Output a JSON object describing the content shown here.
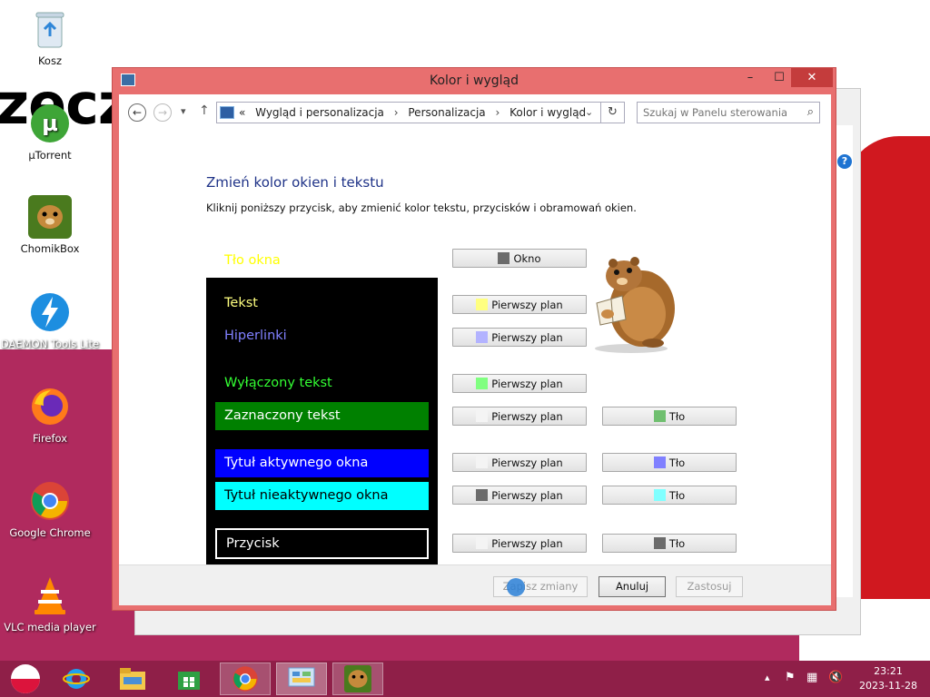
{
  "desktop": {
    "wallpaper_text": "zecz",
    "icons": [
      {
        "label": "Kosz",
        "icon": "recycle-bin-icon"
      },
      {
        "label": "µTorrent",
        "icon": "utorrent-icon"
      },
      {
        "label": "ChomikBox",
        "icon": "chomikbox-icon"
      },
      {
        "label": "DAEMON Tools Lite",
        "icon": "daemon-tools-icon"
      },
      {
        "label": "Firefox",
        "icon": "firefox-icon"
      },
      {
        "label": "Google Chrome",
        "icon": "chrome-icon"
      },
      {
        "label": "VLC media player",
        "icon": "vlc-icon"
      }
    ]
  },
  "dialog": {
    "title": "Kolor i wygląd",
    "controls": {
      "minimize": "–",
      "maximize": "☐",
      "close": "✕"
    },
    "nav": {
      "back": "←",
      "forward": "→",
      "recent": "▾",
      "up": "↑",
      "crumb_prefix": "«",
      "breadcrumb": [
        "Wygląd i personalizacja",
        "Personalizacja",
        "Kolor i wygląd"
      ],
      "dropdown": "⌄",
      "refresh": "↻",
      "search_placeholder": "Szukaj w Panelu sterowania",
      "search_icon": "⌕"
    },
    "heading": "Zmień kolor okien i tekstu",
    "description": "Kliknij poniższy przycisk, aby zmienić kolor tekstu, przycisków i obramowań okien.",
    "window_bg_label": "Tło okna",
    "preview": {
      "text": "Tekst",
      "hyperlinks": "Hiperlinki",
      "disabled_text": "Wyłączony tekst",
      "selected_text": "Zaznaczony tekst",
      "active_title": "Tytuł aktywnego okna",
      "inactive_title": "Tytuł nieaktywnego okna",
      "button": "Przycisk"
    },
    "buttons": {
      "window": "Okno",
      "foreground": "Pierwszy plan",
      "background": "Tło"
    },
    "colors": {
      "window_swatch": "#6b6b6b",
      "text_fg": "#ffff80",
      "hyperlink_fg": "#b3b3ff",
      "disabled_fg": "#80ff80",
      "selected_fg": "#f4f4f4",
      "selected_bg": "#6fbf6f",
      "active_title_fg": "#f4f4f4",
      "active_title_bg": "#8080ff",
      "inactive_title_fg": "#6b6b6b",
      "inactive_title_bg": "#80ffff",
      "button_fg": "#f4f4f4",
      "button_bg": "#6b6b6b",
      "preview_window_bg": "#000000",
      "preview_text": "#ffff80",
      "preview_link": "#8080ff",
      "preview_disabled": "#33ff33",
      "preview_selected_bg": "#008000",
      "preview_active_bg": "#0000ff",
      "preview_inactive_bg": "#00ffff",
      "preview_inactive_fg": "#000000",
      "window_label_color": "#ffff00"
    },
    "footer": {
      "save": "Zapisz zmiany",
      "cancel": "Anuluj",
      "apply": "Zastosuj"
    }
  },
  "taskbar": {
    "apps": [
      "windows-flag-icon",
      "internet-explorer-icon",
      "file-explorer-icon",
      "store-icon",
      "chrome-icon",
      "control-panel-icon",
      "chomikbox-icon"
    ],
    "clock_time": "23:21",
    "clock_date": "2023-11-28"
  }
}
